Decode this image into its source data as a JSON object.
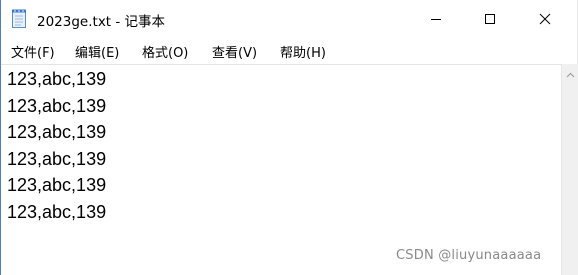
{
  "window": {
    "title": "2023ge.txt - 记事本",
    "icon": "notepad-icon"
  },
  "controls": {
    "minimize_icon": "minimize-icon",
    "maximize_icon": "maximize-icon",
    "close_icon": "close-icon"
  },
  "menu": {
    "items": [
      {
        "label": "文件(F)"
      },
      {
        "label": "编辑(E)"
      },
      {
        "label": "格式(O)"
      },
      {
        "label": "查看(V)"
      },
      {
        "label": "帮助(H)"
      }
    ]
  },
  "editor": {
    "lines": [
      "123,abc,139",
      "123,abc,139",
      "123,abc,139",
      "123,abc,139",
      "123,abc,139",
      "123,abc,139"
    ]
  },
  "watermark": {
    "text": "CSDN @liuyunaaaaaa"
  },
  "colors": {
    "window_border": "#4a7fc0",
    "scrollbar_track": "#f0f0f0",
    "watermark": "#8a8a8a"
  }
}
